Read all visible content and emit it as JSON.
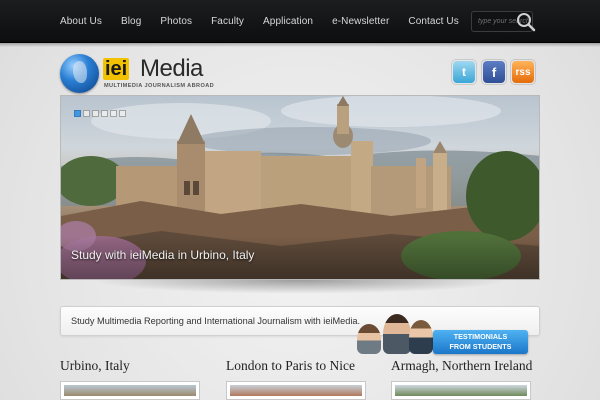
{
  "nav": {
    "items": [
      "About Us",
      "Blog",
      "Photos",
      "Faculty",
      "Application",
      "e-Newsletter",
      "Contact Us"
    ],
    "search_placeholder": "type your search"
  },
  "logo": {
    "ie": "iei",
    "media": "Media",
    "tagline": "MULTIMEDIA JOURNALISM ABROAD"
  },
  "social": {
    "twitter": "t",
    "facebook": "f",
    "rss": "rss"
  },
  "slider": {
    "caption": "Study with ieiMedia in Urbino, Italy",
    "slide_count": 6,
    "active_slide": 1
  },
  "intro": {
    "text": "Study Multimedia Reporting and International Journalism with ieiMedia.",
    "testimonials_line1": "TESTIMONIALS",
    "testimonials_line2": "FROM STUDENTS"
  },
  "sections": [
    {
      "title": "Urbino, Italy"
    },
    {
      "title": "London to Paris to Nice"
    },
    {
      "title": "Armagh, Northern Ireland"
    }
  ],
  "colors": {
    "accent": "#2f8fe0",
    "logo_yellow": "#f2c200",
    "topbar": "#111213"
  }
}
